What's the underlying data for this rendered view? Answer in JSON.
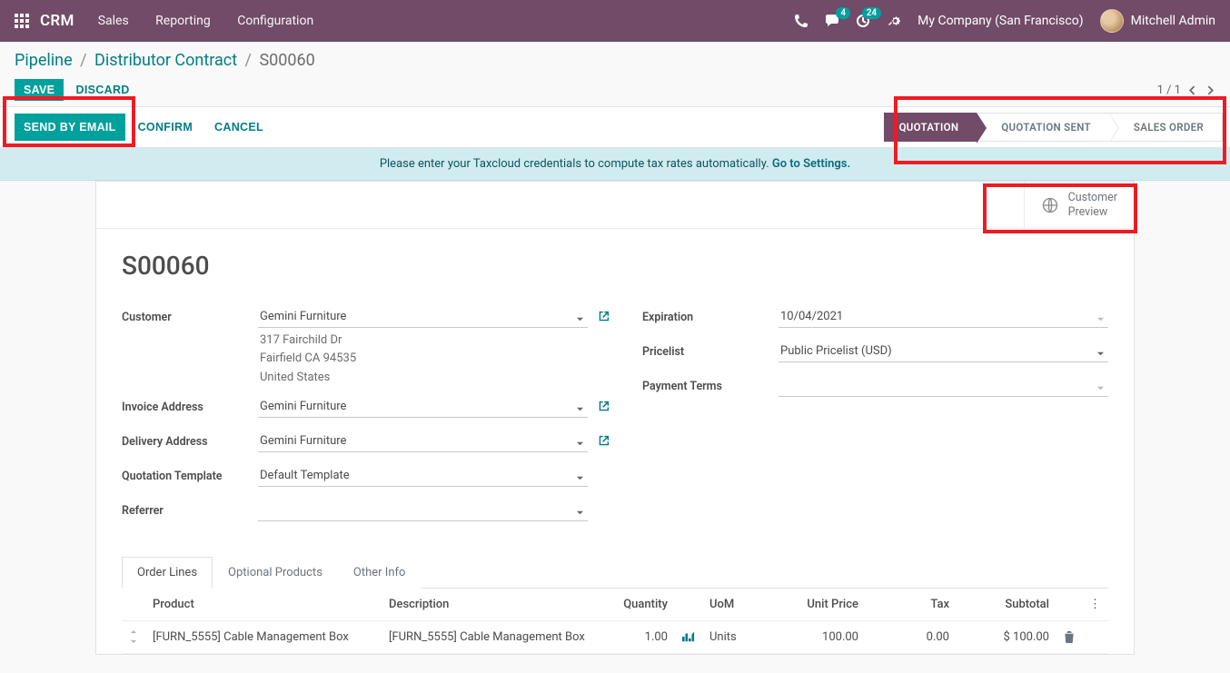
{
  "nav": {
    "brand": "CRM",
    "menu": [
      "Sales",
      "Reporting",
      "Configuration"
    ],
    "chat_badge": "4",
    "activity_badge": "24",
    "company": "My Company (San Francisco)",
    "user": "Mitchell Admin"
  },
  "breadcrumb": {
    "a": "Pipeline",
    "b": "Distributor Contract",
    "c": "S00060"
  },
  "cp": {
    "save": "SAVE",
    "discard": "DISCARD",
    "pager": "1 / 1"
  },
  "statusbar": {
    "send_email": "SEND BY EMAIL",
    "confirm": "CONFIRM",
    "cancel": "CANCEL",
    "stages": [
      "QUOTATION",
      "QUOTATION SENT",
      "SALES ORDER"
    ]
  },
  "banner": {
    "text": "Please enter your Taxcloud credentials to compute tax rates automatically. ",
    "link": "Go to Settings."
  },
  "button_box": {
    "customer_preview_l1": "Customer",
    "customer_preview_l2": "Preview"
  },
  "record": {
    "title": "S00060",
    "labels": {
      "customer": "Customer",
      "invoice_addr": "Invoice Address",
      "delivery_addr": "Delivery Address",
      "template": "Quotation Template",
      "referrer": "Referrer",
      "expiration": "Expiration",
      "pricelist": "Pricelist",
      "payment_terms": "Payment Terms"
    },
    "customer": "Gemini Furniture",
    "address_lines": [
      "317 Fairchild Dr",
      "Fairfield CA 94535",
      "United States"
    ],
    "invoice_address": "Gemini Furniture",
    "delivery_address": "Gemini Furniture",
    "template": "Default Template",
    "referrer": "",
    "expiration": "10/04/2021",
    "pricelist": "Public Pricelist (USD)",
    "payment_terms": ""
  },
  "tabs": [
    "Order Lines",
    "Optional Products",
    "Other Info"
  ],
  "table": {
    "headers": {
      "product": "Product",
      "description": "Description",
      "quantity": "Quantity",
      "uom": "UoM",
      "unit_price": "Unit Price",
      "tax": "Tax",
      "subtotal": "Subtotal"
    },
    "rows": [
      {
        "product": "[FURN_5555] Cable Management Box",
        "description": "[FURN_5555] Cable Management Box",
        "quantity": "1.00",
        "uom": "Units",
        "unit_price": "100.00",
        "tax": "0.00",
        "subtotal": "$ 100.00"
      }
    ]
  }
}
